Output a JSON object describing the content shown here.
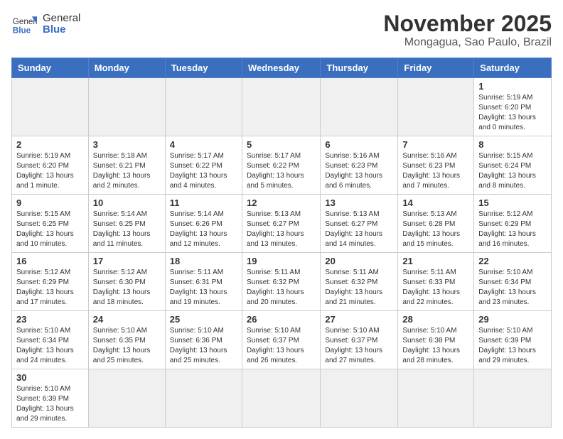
{
  "header": {
    "logo_general": "General",
    "logo_blue": "Blue",
    "month_title": "November 2025",
    "location": "Mongagua, Sao Paulo, Brazil"
  },
  "days_of_week": [
    "Sunday",
    "Monday",
    "Tuesday",
    "Wednesday",
    "Thursday",
    "Friday",
    "Saturday"
  ],
  "weeks": [
    [
      {
        "day": "",
        "info": ""
      },
      {
        "day": "",
        "info": ""
      },
      {
        "day": "",
        "info": ""
      },
      {
        "day": "",
        "info": ""
      },
      {
        "day": "",
        "info": ""
      },
      {
        "day": "",
        "info": ""
      },
      {
        "day": "1",
        "info": "Sunrise: 5:19 AM\nSunset: 6:20 PM\nDaylight: 13 hours and 0 minutes."
      }
    ],
    [
      {
        "day": "2",
        "info": "Sunrise: 5:19 AM\nSunset: 6:20 PM\nDaylight: 13 hours and 1 minute."
      },
      {
        "day": "3",
        "info": "Sunrise: 5:18 AM\nSunset: 6:21 PM\nDaylight: 13 hours and 2 minutes."
      },
      {
        "day": "4",
        "info": "Sunrise: 5:17 AM\nSunset: 6:22 PM\nDaylight: 13 hours and 4 minutes."
      },
      {
        "day": "5",
        "info": "Sunrise: 5:17 AM\nSunset: 6:22 PM\nDaylight: 13 hours and 5 minutes."
      },
      {
        "day": "6",
        "info": "Sunrise: 5:16 AM\nSunset: 6:23 PM\nDaylight: 13 hours and 6 minutes."
      },
      {
        "day": "7",
        "info": "Sunrise: 5:16 AM\nSunset: 6:23 PM\nDaylight: 13 hours and 7 minutes."
      },
      {
        "day": "8",
        "info": "Sunrise: 5:15 AM\nSunset: 6:24 PM\nDaylight: 13 hours and 8 minutes."
      }
    ],
    [
      {
        "day": "9",
        "info": "Sunrise: 5:15 AM\nSunset: 6:25 PM\nDaylight: 13 hours and 10 minutes."
      },
      {
        "day": "10",
        "info": "Sunrise: 5:14 AM\nSunset: 6:25 PM\nDaylight: 13 hours and 11 minutes."
      },
      {
        "day": "11",
        "info": "Sunrise: 5:14 AM\nSunset: 6:26 PM\nDaylight: 13 hours and 12 minutes."
      },
      {
        "day": "12",
        "info": "Sunrise: 5:13 AM\nSunset: 6:27 PM\nDaylight: 13 hours and 13 minutes."
      },
      {
        "day": "13",
        "info": "Sunrise: 5:13 AM\nSunset: 6:27 PM\nDaylight: 13 hours and 14 minutes."
      },
      {
        "day": "14",
        "info": "Sunrise: 5:13 AM\nSunset: 6:28 PM\nDaylight: 13 hours and 15 minutes."
      },
      {
        "day": "15",
        "info": "Sunrise: 5:12 AM\nSunset: 6:29 PM\nDaylight: 13 hours and 16 minutes."
      }
    ],
    [
      {
        "day": "16",
        "info": "Sunrise: 5:12 AM\nSunset: 6:29 PM\nDaylight: 13 hours and 17 minutes."
      },
      {
        "day": "17",
        "info": "Sunrise: 5:12 AM\nSunset: 6:30 PM\nDaylight: 13 hours and 18 minutes."
      },
      {
        "day": "18",
        "info": "Sunrise: 5:11 AM\nSunset: 6:31 PM\nDaylight: 13 hours and 19 minutes."
      },
      {
        "day": "19",
        "info": "Sunrise: 5:11 AM\nSunset: 6:32 PM\nDaylight: 13 hours and 20 minutes."
      },
      {
        "day": "20",
        "info": "Sunrise: 5:11 AM\nSunset: 6:32 PM\nDaylight: 13 hours and 21 minutes."
      },
      {
        "day": "21",
        "info": "Sunrise: 5:11 AM\nSunset: 6:33 PM\nDaylight: 13 hours and 22 minutes."
      },
      {
        "day": "22",
        "info": "Sunrise: 5:10 AM\nSunset: 6:34 PM\nDaylight: 13 hours and 23 minutes."
      }
    ],
    [
      {
        "day": "23",
        "info": "Sunrise: 5:10 AM\nSunset: 6:34 PM\nDaylight: 13 hours and 24 minutes."
      },
      {
        "day": "24",
        "info": "Sunrise: 5:10 AM\nSunset: 6:35 PM\nDaylight: 13 hours and 25 minutes."
      },
      {
        "day": "25",
        "info": "Sunrise: 5:10 AM\nSunset: 6:36 PM\nDaylight: 13 hours and 25 minutes."
      },
      {
        "day": "26",
        "info": "Sunrise: 5:10 AM\nSunset: 6:37 PM\nDaylight: 13 hours and 26 minutes."
      },
      {
        "day": "27",
        "info": "Sunrise: 5:10 AM\nSunset: 6:37 PM\nDaylight: 13 hours and 27 minutes."
      },
      {
        "day": "28",
        "info": "Sunrise: 5:10 AM\nSunset: 6:38 PM\nDaylight: 13 hours and 28 minutes."
      },
      {
        "day": "29",
        "info": "Sunrise: 5:10 AM\nSunset: 6:39 PM\nDaylight: 13 hours and 29 minutes."
      }
    ],
    [
      {
        "day": "30",
        "info": "Sunrise: 5:10 AM\nSunset: 6:39 PM\nDaylight: 13 hours and 29 minutes."
      },
      {
        "day": "",
        "info": ""
      },
      {
        "day": "",
        "info": ""
      },
      {
        "day": "",
        "info": ""
      },
      {
        "day": "",
        "info": ""
      },
      {
        "day": "",
        "info": ""
      },
      {
        "day": "",
        "info": ""
      }
    ]
  ]
}
